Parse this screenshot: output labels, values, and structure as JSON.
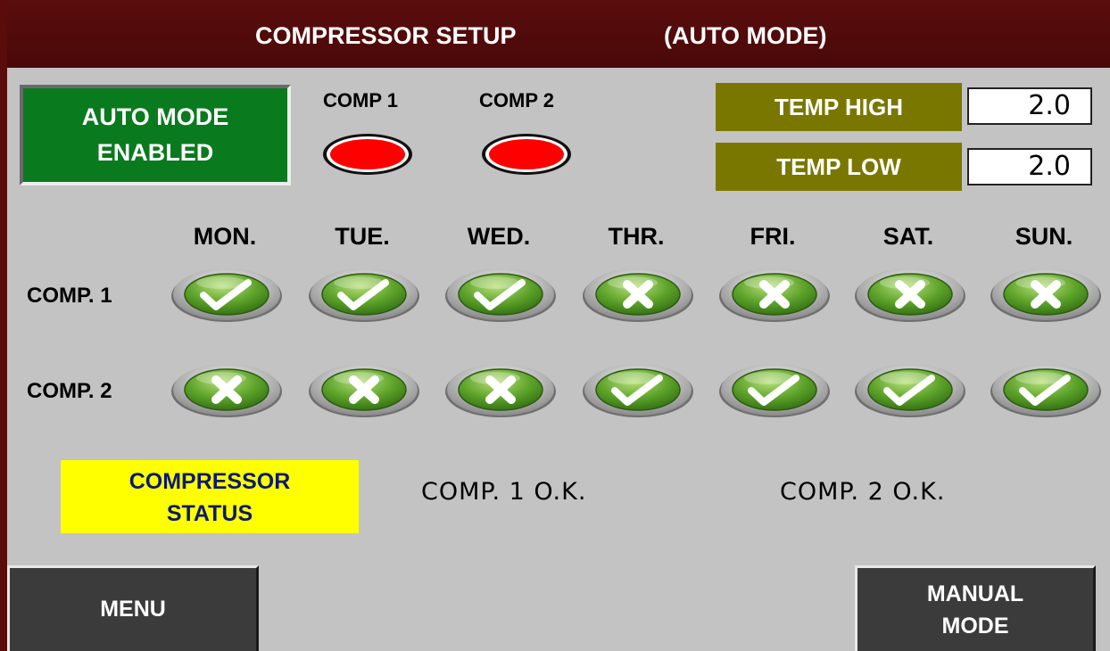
{
  "header": {
    "title": "COMPRESSOR SETUP",
    "mode": "(AUTO MODE)"
  },
  "auto_mode": {
    "line1": "AUTO MODE",
    "line2": "ENABLED",
    "color": "#0a7a1e"
  },
  "lamps": [
    {
      "label": "COMP 1",
      "state": "off",
      "color": "#ff0000"
    },
    {
      "label": "COMP 2",
      "state": "off",
      "color": "#ff0000"
    }
  ],
  "temps": {
    "high": {
      "label": "TEMP HIGH",
      "value": "2.0"
    },
    "low": {
      "label": "TEMP LOW",
      "value": "2.0"
    }
  },
  "schedule": {
    "days": [
      "MON.",
      "TUE.",
      "WED.",
      "THR.",
      "FRI.",
      "SAT.",
      "SUN."
    ],
    "rows": [
      {
        "label": "COMP. 1",
        "enabled": [
          true,
          true,
          true,
          false,
          false,
          false,
          false
        ]
      },
      {
        "label": "COMP. 2",
        "enabled": [
          false,
          false,
          false,
          true,
          true,
          true,
          true
        ]
      }
    ],
    "icons": {
      "on": "check-icon",
      "off": "cross-icon"
    }
  },
  "status": {
    "label_line1": "COMPRESSOR",
    "label_line2": "STATUS",
    "comp1": "COMP. 1 O.K.",
    "comp2": "COMP. 2 O.K.",
    "label_bg": "#ffff00"
  },
  "buttons": {
    "menu": "MENU",
    "manual_line1": "MANUAL",
    "manual_line2": "MODE"
  }
}
